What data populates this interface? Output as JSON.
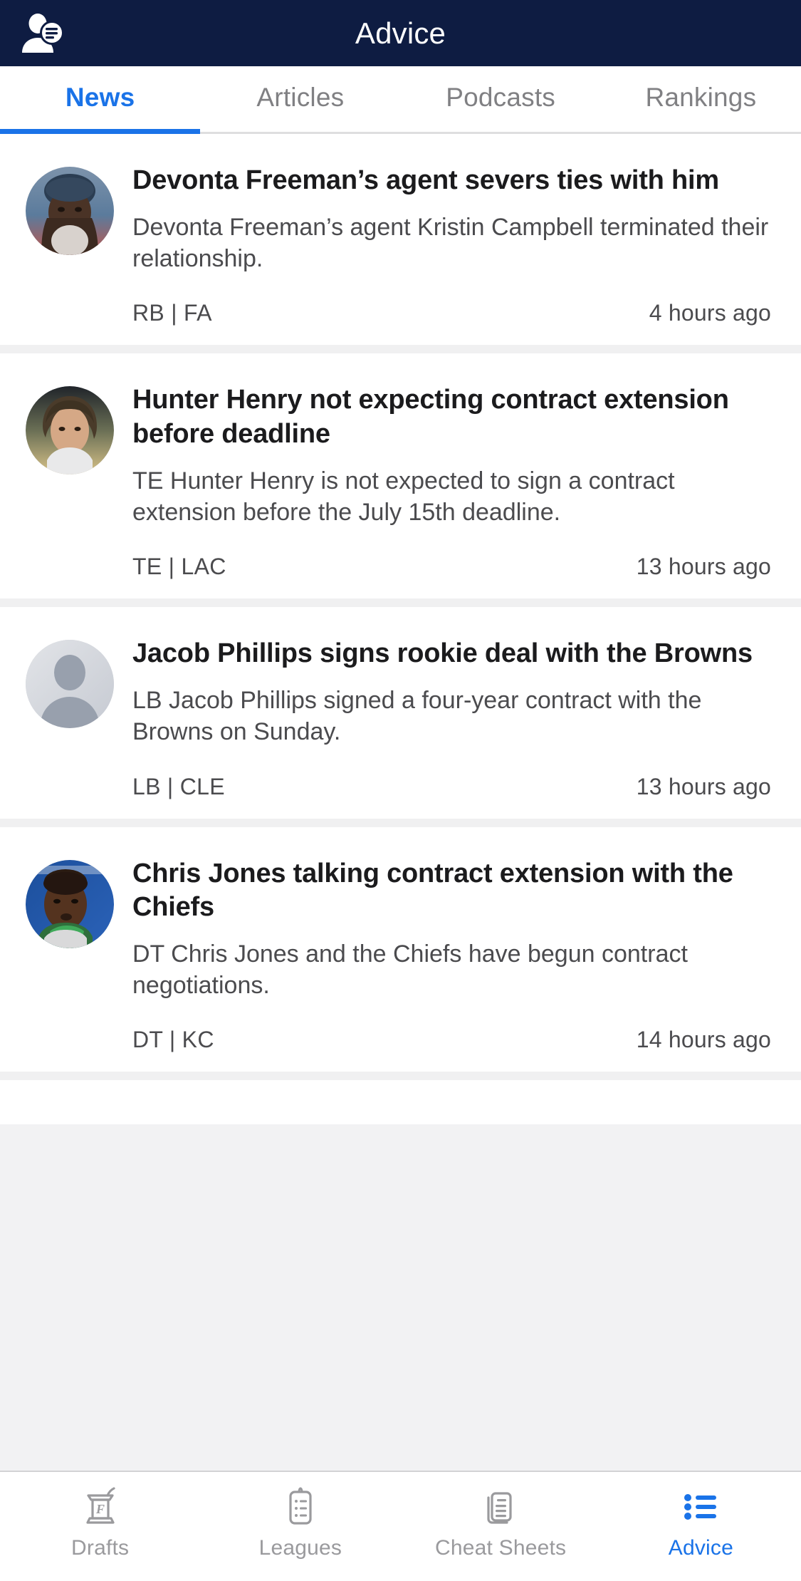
{
  "header": {
    "title": "Advice",
    "left_icon": "person-message-icon"
  },
  "tabs": [
    {
      "label": "News",
      "active": true
    },
    {
      "label": "Articles",
      "active": false
    },
    {
      "label": "Podcasts",
      "active": false
    },
    {
      "label": "Rankings",
      "active": false
    }
  ],
  "news": [
    {
      "avatar": "player-photo",
      "title": "Devonta Freeman’s agent severs ties with him",
      "summary": "Devonta Freeman’s agent Kristin Campbell terminated their relationship.",
      "position_team": "RB | FA",
      "time": "4 hours ago"
    },
    {
      "avatar": "player-photo",
      "title": "Hunter Henry not expecting contract extension before deadline",
      "summary": "TE Hunter Henry is not expected to sign a contract extension before the July 15th deadline.",
      "position_team": "TE | LAC",
      "time": "13 hours ago"
    },
    {
      "avatar": "placeholder-silhouette",
      "title": "Jacob Phillips signs rookie deal with the Browns",
      "summary": "LB Jacob Phillips signed a four-year contract with the Browns on Sunday.",
      "position_team": "LB | CLE",
      "time": "13 hours ago"
    },
    {
      "avatar": "player-photo",
      "title": "Chris Jones talking contract extension with the Chiefs",
      "summary": "DT Chris Jones and the Chiefs have begun contract negotiations.",
      "position_team": "DT | KC",
      "time": "14 hours ago"
    }
  ],
  "bottom_nav": [
    {
      "label": "Drafts",
      "icon": "podium-draft-icon",
      "active": false
    },
    {
      "label": "Leagues",
      "icon": "clipboard-icon",
      "active": false
    },
    {
      "label": "Cheat Sheets",
      "icon": "documents-icon",
      "active": false
    },
    {
      "label": "Advice",
      "icon": "bulleted-list-icon",
      "active": true
    }
  ],
  "colors": {
    "header_background": "#0e1c42",
    "accent": "#1a73e8",
    "inactive_text": "#808083",
    "body_text": "#1b1b1d",
    "summary_text": "#4b4b4e",
    "separator": "#f0f0f1",
    "nav_inactive": "#9a9a9d"
  }
}
